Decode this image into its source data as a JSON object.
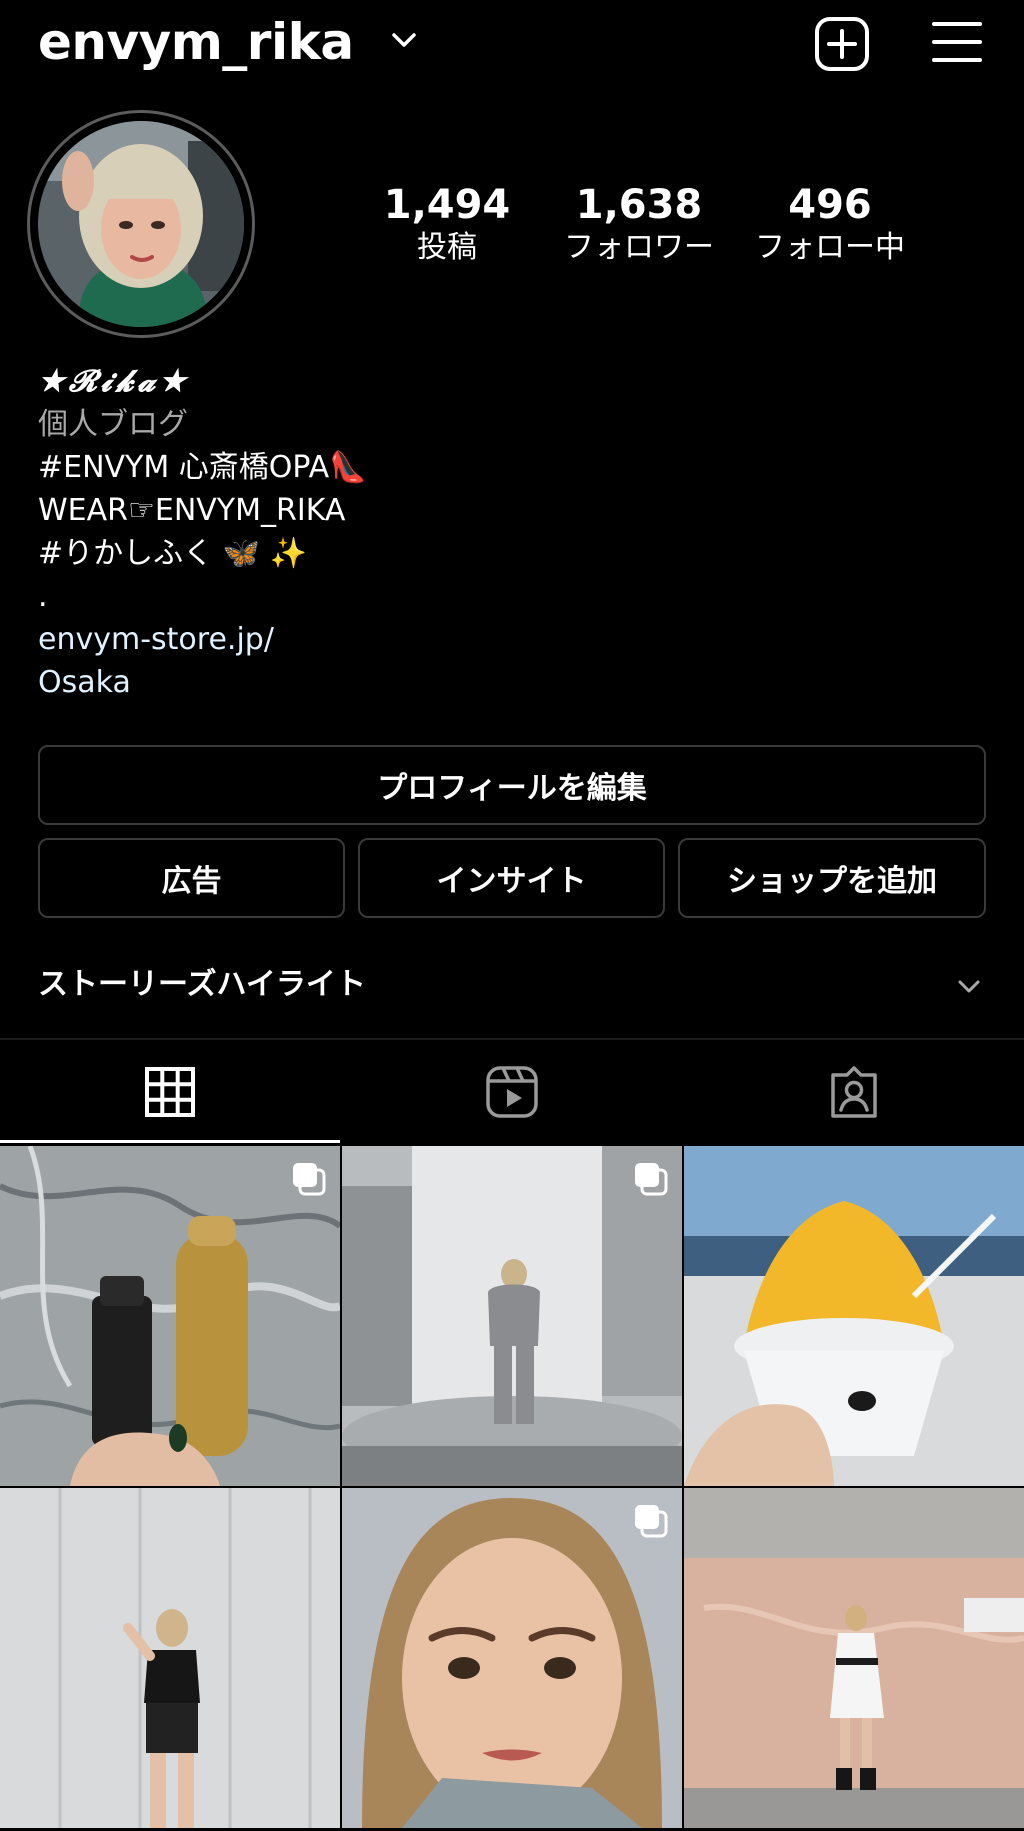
{
  "header": {
    "username": "envym_rika"
  },
  "stats": [
    {
      "value": "1,494",
      "label": "投稿"
    },
    {
      "value": "1,638",
      "label": "フォロワー"
    },
    {
      "value": "496",
      "label": "フォロー中"
    }
  ],
  "bio": {
    "name": "★𝓡𝓲𝓴𝓪★",
    "category": "個人ブログ",
    "lines": [
      "#ENVYM 心斎橋OPA👠",
      "WEAR☞ENVYM_RIKA",
      "#りかしふく 🦋 ✨",
      "."
    ],
    "link": "envym-store.jp/",
    "location": "Osaka"
  },
  "buttons": {
    "edit_profile": "プロフィールを編集",
    "ads": "広告",
    "insights": "インサイト",
    "add_shop": "ショップを追加"
  },
  "highlights": {
    "label": "ストーリーズハイライト"
  },
  "tabs": [
    {
      "icon": "grid-icon",
      "active": true
    },
    {
      "icon": "reels-icon",
      "active": false
    },
    {
      "icon": "tagged-icon",
      "active": false
    }
  ],
  "posts": [
    {
      "subject": "hair spray products",
      "multi": true
    },
    {
      "subject": "person by pillar",
      "multi": true
    },
    {
      "subject": "shaved ice dessert",
      "multi": false
    },
    {
      "subject": "person in black outfit",
      "multi": false
    },
    {
      "subject": "selfie portrait",
      "multi": true
    },
    {
      "subject": "person in white dress",
      "multi": false
    }
  ],
  "colors": {
    "background": "#000000",
    "text": "#ffffff",
    "secondary_text": "#a8a8a8",
    "link": "#e0f1ff",
    "button_border": "#3a3a3a"
  }
}
